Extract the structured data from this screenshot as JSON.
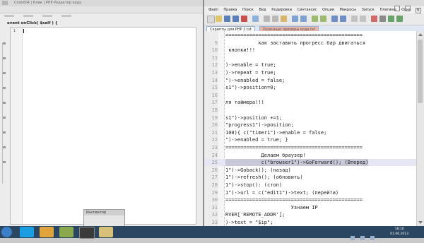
{
  "left_window": {
    "title": "Cnsb004 | Клик | PHP Редактор кода",
    "event_header": "event onClick( $self ) {",
    "first_line_number": "1",
    "inspector_title": "Инспектор"
  },
  "right_window": {
    "menu": [
      "Файл",
      "Правка",
      "Поиск",
      "Вид",
      "Кодировки",
      "Синтаксис",
      "Опции",
      "Макросы",
      "Запуск",
      "Плагины",
      "Окна",
      "?"
    ],
    "tabs": [
      "Скрипты для PHP 2.txt",
      "Полезные примеры кода.txt"
    ],
    "close_label": "X",
    "lines": [
      {
        "n": "",
        "t": "==============================================",
        "hl": false
      },
      {
        "n": "9",
        "t": "           как заставить прогресс бар двигаться",
        "hl": false
      },
      {
        "n": "10",
        "t": " кнопки!!!",
        "hl": false
      },
      {
        "n": "11",
        "t": "",
        "hl": false
      },
      {
        "n": "12",
        "t": ")->enable = true;",
        "hl": false
      },
      {
        "n": "13",
        "t": ")->repeat = true;",
        "hl": false
      },
      {
        "n": "14",
        "t": "\")->enabled = false;",
        "hl": false
      },
      {
        "n": "15",
        "t": "s1\")->position=0;",
        "hl": false
      },
      {
        "n": "16",
        "t": "",
        "hl": false
      },
      {
        "n": "17",
        "t": "ля таймера!!!",
        "hl": false
      },
      {
        "n": "18",
        "t": "",
        "hl": false
      },
      {
        "n": "19",
        "t": "s1\")->position +=1;",
        "hl": false
      },
      {
        "n": "20",
        "t": "\"progress1\")->position;",
        "hl": false
      },
      {
        "n": "21",
        "t": "100){ c(\"timer1\")->enable = false;",
        "hl": false
      },
      {
        "n": "22",
        "t": "\")->enabled = true; }",
        "hl": false
      },
      {
        "n": "23",
        "t": "==============================================",
        "hl": false
      },
      {
        "n": "24",
        "t": "            Делаем браузер!",
        "hl": false
      },
      {
        "n": "25",
        "t": "            c(\"browser1\")->GoForward(); (Вперед)",
        "hl": true
      },
      {
        "n": "26",
        "t": "1\")->Goback(); (назад)",
        "hl": false
      },
      {
        "n": "27",
        "t": "1\")->refresh(); (обновить)",
        "hl": false
      },
      {
        "n": "28",
        "t": "1\")->stop(): (стоп)",
        "hl": false
      },
      {
        "n": "29",
        "t": "1\")->url = c(\"edit1\")->text; (перейти)",
        "hl": false
      },
      {
        "n": "30",
        "t": "==============================================",
        "hl": false
      },
      {
        "n": "31",
        "t": "                      Узнаем IP",
        "hl": false
      },
      {
        "n": "32",
        "t": "RVER['REMOTE_ADDR'];",
        "hl": false
      },
      {
        "n": "33",
        "t": ")->text = \"$ip\";",
        "hl": false
      }
    ]
  },
  "taskbar": {
    "time": "18:10",
    "date": "01.06.2013"
  }
}
